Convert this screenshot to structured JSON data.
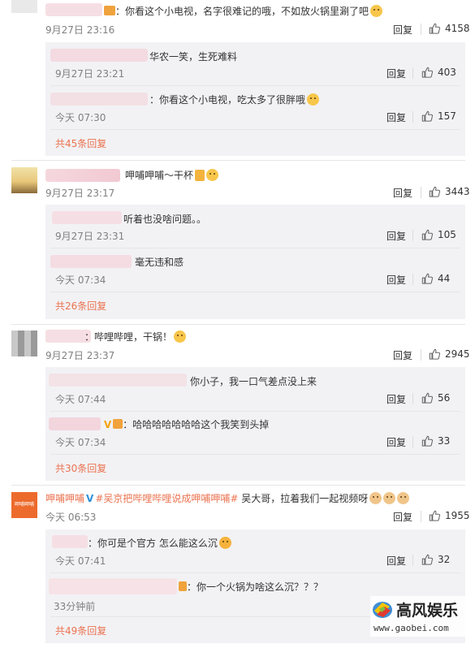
{
  "comments": [
    {
      "text": "：你看这个小电视，名字很难记的哦，不如放火锅里涮了吧",
      "time": "9月27日 23:16",
      "reply": "回复",
      "likes": "4158",
      "subs": [
        {
          "text": "华农一笑，生死难料",
          "time": "9月27日 23:21",
          "reply": "回复",
          "likes": "403"
        },
        {
          "text": "：你看这个小电视，吃太多了很胖哦",
          "time": "今天 07:30",
          "reply": "回复",
          "likes": "157"
        }
      ],
      "more": "共45条回复"
    },
    {
      "text": "呷哺呷哺～干杯",
      "time": "9月27日 23:17",
      "reply": "回复",
      "likes": "3443",
      "subs": [
        {
          "text": "听着也没啥问题。。",
          "time": "9月27日 23:31",
          "reply": "回复",
          "likes": "105"
        },
        {
          "text": "毫无违和感",
          "time": "今天 07:34",
          "reply": "回复",
          "likes": "44"
        }
      ],
      "more": "共26条回复"
    },
    {
      "text": "：哔哩哔哩，干锅！",
      "time": "9月27日 23:37",
      "reply": "回复",
      "likes": "2945",
      "subs": [
        {
          "text": "你小子，我一口气差点没上来",
          "time": "今天 07:44",
          "reply": "回复",
          "likes": "56"
        },
        {
          "text": "：哈哈哈哈哈哈哈这个我笑到头掉",
          "time": "今天 07:34",
          "reply": "回复",
          "likes": "33"
        }
      ],
      "more": "共30条回复"
    },
    {
      "name": "呷哺呷哺",
      "avatar_text": "呷哺呷哺",
      "hashtag": "#吴京把哔哩哔哩说成呷哺呷哺#",
      "text": " 吴大哥，拉着我们一起视频呀",
      "time": "今天 06:53",
      "reply": "回复",
      "likes": "1955",
      "subs": [
        {
          "text": "：你可是个官方 怎么能这么沉",
          "time": "今天 07:41",
          "reply": "回复",
          "likes": "32"
        },
        {
          "text": "：你一个火锅为啥这么沉？？？",
          "time": "33分钟前",
          "reply": "",
          "likes": ""
        }
      ],
      "more": "共49条回复"
    }
  ],
  "watermark": {
    "brand": "高风娱乐",
    "url": "www.gaobei.com"
  },
  "colors": {
    "accent": "#eb7350",
    "subbox": "#f2f2f5",
    "muted": "#808080"
  },
  "icons": [
    "thumbs-up-icon",
    "laugh-emoji-icon",
    "verified-v-icon"
  ]
}
